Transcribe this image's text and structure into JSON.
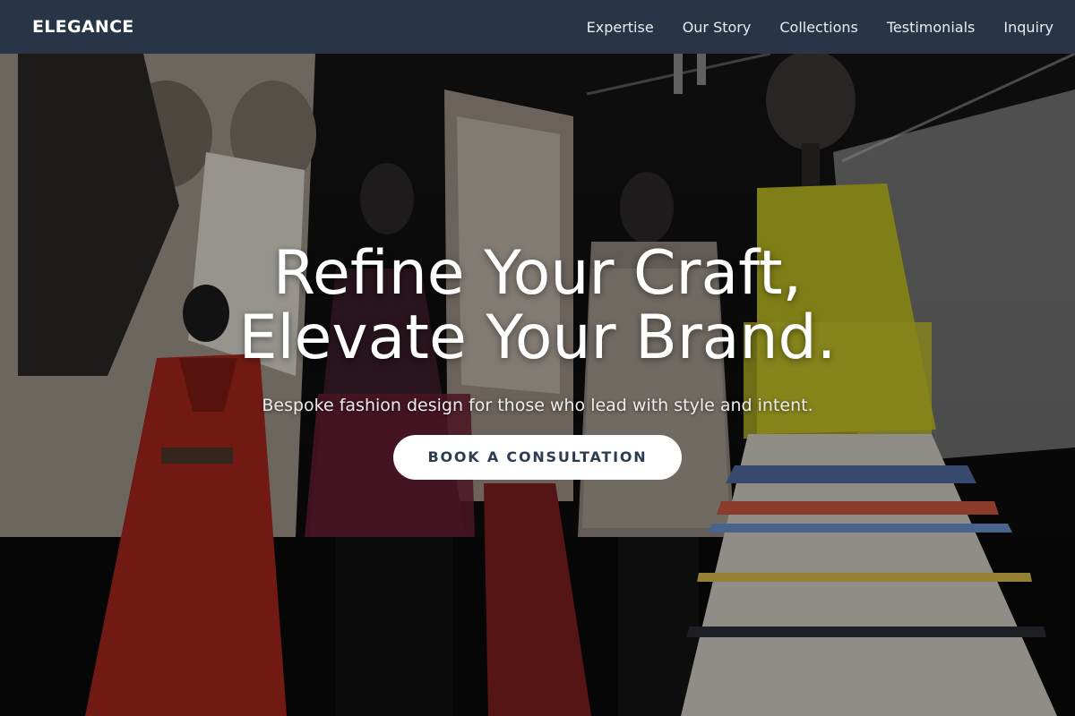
{
  "nav": {
    "brand": "ELEGANCE",
    "links": [
      "Expertise",
      "Our Story",
      "Collections",
      "Testimonials",
      "Inquiry"
    ]
  },
  "hero": {
    "headline_line1": "Refine Your Craft,",
    "headline_line2": "Elevate Your Brand.",
    "subheadline": "Bespoke fashion design for those who lead with style and intent.",
    "cta_label": "BOOK A CONSULTATION"
  },
  "colors": {
    "navbar": "#29384b",
    "cta_text": "#2c3d52",
    "cta_background": "#ffffff"
  }
}
